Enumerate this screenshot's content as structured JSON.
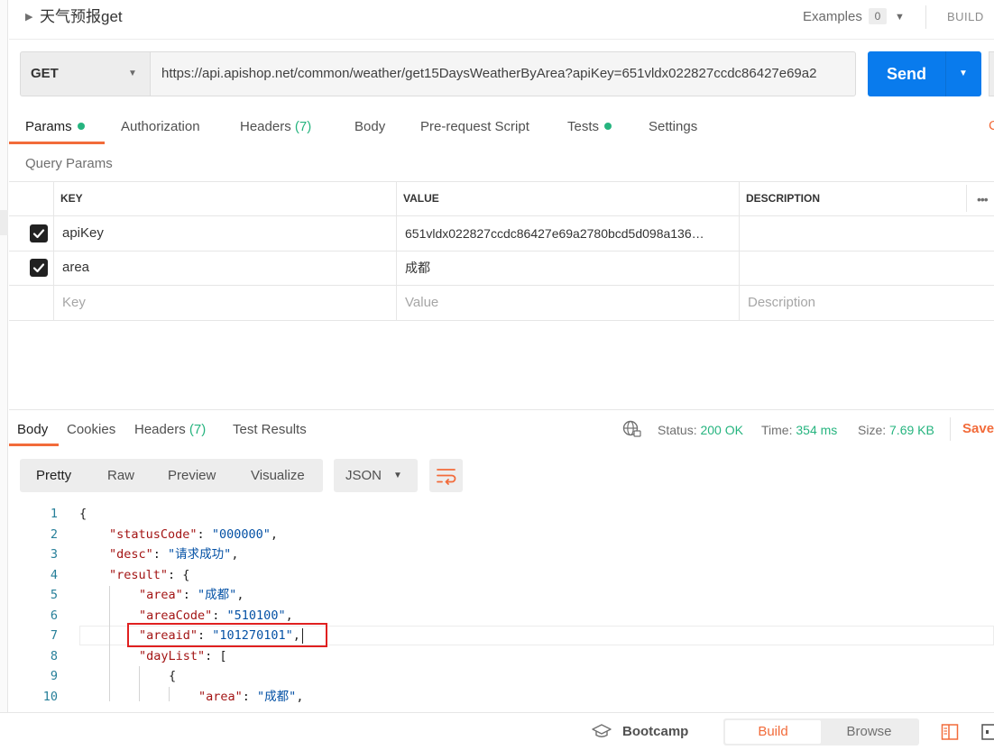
{
  "request": {
    "name": "天气预报get",
    "examples_label": "Examples",
    "examples_count": "0",
    "build_label": "BUILD",
    "method": "GET",
    "url": "https://api.apishop.net/common/weather/get15DaysWeatherByArea?apiKey=651vldx022827ccdc86427e69a2",
    "send_label": "Send"
  },
  "tabs": [
    {
      "label": "Params"
    },
    {
      "label": "Authorization"
    },
    {
      "label": "Headers",
      "count": "(7)"
    },
    {
      "label": "Body"
    },
    {
      "label": "Pre-request Script"
    },
    {
      "label": "Tests"
    },
    {
      "label": "Settings"
    }
  ],
  "cookies_stub": "C",
  "query_params": {
    "title": "Query Params",
    "headers": {
      "key": "KEY",
      "value": "VALUE",
      "description": "DESCRIPTION"
    },
    "rows": [
      {
        "checked": true,
        "key": "apiKey",
        "value": "651vldx022827ccdc86427e69a2780bcd5d098a136…",
        "description": ""
      },
      {
        "checked": true,
        "key": "area",
        "value": "成都",
        "description": ""
      }
    ],
    "placeholder": {
      "key": "Key",
      "value": "Value",
      "description": "Description"
    }
  },
  "response": {
    "tabs": [
      {
        "label": "Body"
      },
      {
        "label": "Cookies"
      },
      {
        "label": "Headers",
        "count": "(7)"
      },
      {
        "label": "Test Results"
      }
    ],
    "status_label": "Status:",
    "status_value": "200 OK",
    "time_label": "Time:",
    "time_value": "354 ms",
    "size_label": "Size:",
    "size_value": "7.69 KB",
    "save_label": "Save",
    "views": [
      "Pretty",
      "Raw",
      "Preview",
      "Visualize"
    ],
    "format": "JSON",
    "code_lines": [
      {
        "n": "1",
        "indent": 0,
        "parts": [
          [
            "p",
            "{"
          ]
        ]
      },
      {
        "n": "2",
        "indent": 1,
        "parts": [
          [
            "k",
            "\"statusCode\""
          ],
          [
            "p",
            ": "
          ],
          [
            "s",
            "\"000000\""
          ],
          [
            "p",
            ","
          ]
        ]
      },
      {
        "n": "3",
        "indent": 1,
        "parts": [
          [
            "k",
            "\"desc\""
          ],
          [
            "p",
            ": "
          ],
          [
            "s",
            "\"请求成功\""
          ],
          [
            "p",
            ","
          ]
        ]
      },
      {
        "n": "4",
        "indent": 1,
        "parts": [
          [
            "k",
            "\"result\""
          ],
          [
            "p",
            ": {"
          ]
        ]
      },
      {
        "n": "5",
        "indent": 2,
        "parts": [
          [
            "k",
            "\"area\""
          ],
          [
            "p",
            ": "
          ],
          [
            "s",
            "\"成都\""
          ],
          [
            "p",
            ","
          ]
        ]
      },
      {
        "n": "6",
        "indent": 2,
        "parts": [
          [
            "k",
            "\"areaCode\""
          ],
          [
            "p",
            ": "
          ],
          [
            "s",
            "\"510100\""
          ],
          [
            "p",
            ","
          ]
        ]
      },
      {
        "n": "7",
        "indent": 2,
        "parts": [
          [
            "k",
            "\"areaid\""
          ],
          [
            "p",
            ": "
          ],
          [
            "s",
            "\"101270101\""
          ],
          [
            "p",
            ","
          ]
        ]
      },
      {
        "n": "8",
        "indent": 2,
        "parts": [
          [
            "k",
            "\"dayList\""
          ],
          [
            "p",
            ": ["
          ]
        ]
      },
      {
        "n": "9",
        "indent": 3,
        "parts": [
          [
            "p",
            "{"
          ]
        ]
      },
      {
        "n": "10",
        "indent": 4,
        "parts": [
          [
            "k",
            "\"area\""
          ],
          [
            "p",
            ": "
          ],
          [
            "s",
            "\"成都\""
          ],
          [
            "p",
            ","
          ]
        ]
      }
    ]
  },
  "footer": {
    "bootcamp_label": "Bootcamp",
    "build_label": "Build",
    "browse_label": "Browse"
  },
  "colors": {
    "accent": "#f26b3a",
    "send": "#097bed",
    "success": "#26b47f",
    "highlight_box": "#e02020"
  }
}
